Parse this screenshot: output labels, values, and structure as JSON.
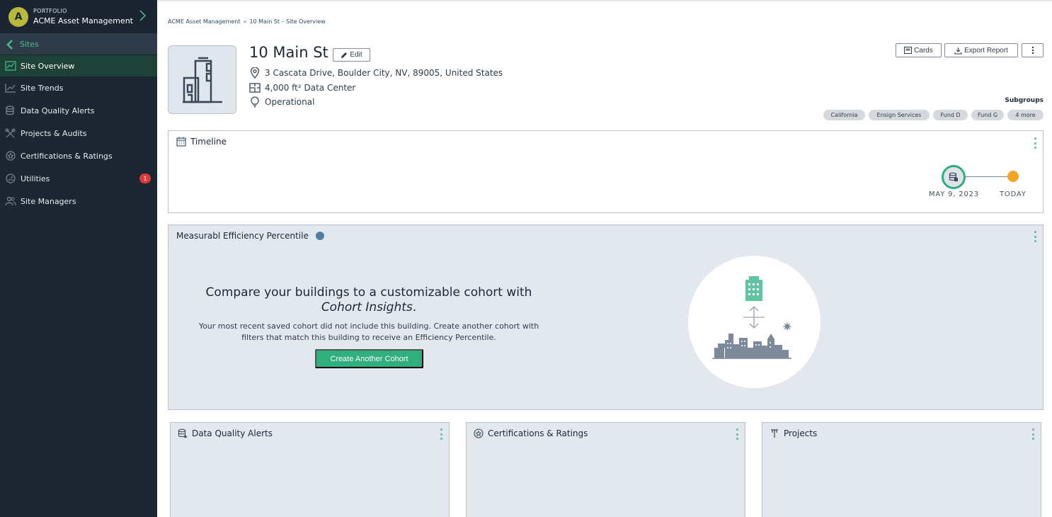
{
  "sidebar": {
    "portfolio": {
      "avatar_letter": "A",
      "kicker": "PORTFOLIO",
      "name": "ACME Asset Management",
      "chevron_icon": "chevron-right-icon"
    },
    "sites_label": "Sites",
    "items": [
      {
        "label": "Site Overview",
        "icon": "chart-icon",
        "active": true
      },
      {
        "label": "Site Trends",
        "icon": "trend-icon"
      },
      {
        "label": "Data Quality Alerts",
        "icon": "database-alert-icon"
      },
      {
        "label": "Projects & Audits",
        "icon": "tools-icon"
      },
      {
        "label": "Certifications & Ratings",
        "icon": "award-icon"
      },
      {
        "label": "Utilities",
        "icon": "utility-icon",
        "badge": "1"
      },
      {
        "label": "Site Managers",
        "icon": "users-icon"
      }
    ]
  },
  "breadcrumb": {
    "portfolio": "ACME Asset Management",
    "separator": "»",
    "current": "10 Main St – Site Overview"
  },
  "site": {
    "name": "10 Main St",
    "edit_label": "Edit",
    "address": "3 Cascata Drive, Boulder City, NV, 89005, United States",
    "size_type": "4,000 ft² Data Center",
    "status": "Operational"
  },
  "actions": {
    "cards_label": "Cards",
    "export_label": "Export Report"
  },
  "subgroups": {
    "label": "Subgroups",
    "chips": [
      "California",
      "Ensign Services",
      "Fund D",
      "Fund G",
      "4 more"
    ]
  },
  "timeline": {
    "title": "Timeline",
    "start_label": "MAY 9, 2023",
    "end_label": "TODAY"
  },
  "efficiency": {
    "title": "Measurabl Efficiency Percentile",
    "heading_line1": "Compare your buildings to a customizable cohort with",
    "heading_emphasis": "Cohort Insights",
    "heading_period": ".",
    "body": "Your most recent saved cohort did not include this building. Create another cohort with filters that match this building to receive an Efficiency Percentile.",
    "button_label": "Create Another Cohort"
  },
  "bottom_cards": [
    {
      "title": "Data Quality Alerts"
    },
    {
      "title": "Certifications & Ratings"
    },
    {
      "title": "Projects"
    }
  ],
  "colors": {
    "sidebar_bg": "#1d2734",
    "accent_green": "#2fae7e",
    "today_orange": "#f4a623",
    "badge_red": "#d93b3b"
  }
}
